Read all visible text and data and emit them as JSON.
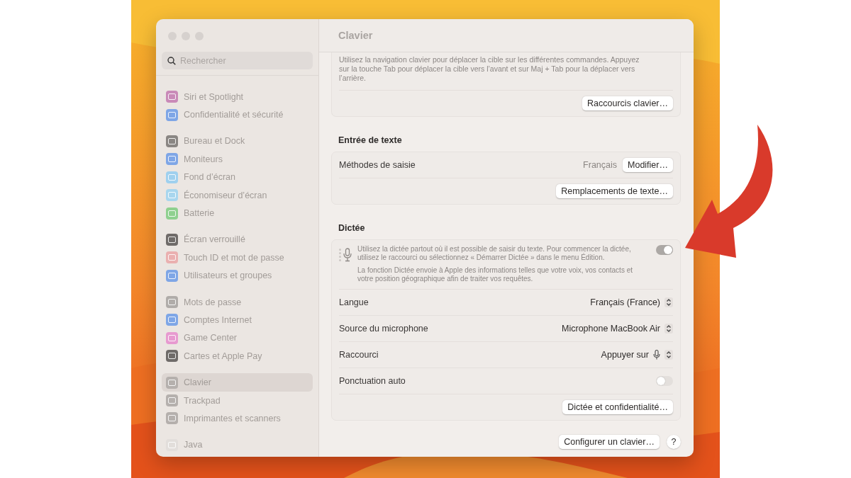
{
  "window": {
    "title": "Clavier"
  },
  "sidebar": {
    "search": {
      "placeholder": "Rechercher"
    },
    "groups": [
      {
        "items": [
          {
            "label": "Siri et Spotlight",
            "color": "#c98ab8",
            "selected": false
          },
          {
            "label": "Confidentialité et sécurité",
            "color": "#7fa6e6",
            "selected": false
          }
        ]
      },
      {
        "items": [
          {
            "label": "Bureau et Dock",
            "color": "#8a8683",
            "selected": false
          },
          {
            "label": "Moniteurs",
            "color": "#7fa6e6",
            "selected": false
          },
          {
            "label": "Fond d’écran",
            "color": "#9fd0ee",
            "selected": false
          },
          {
            "label": "Économiseur d’écran",
            "color": "#a8d6ee",
            "selected": false
          },
          {
            "label": "Batterie",
            "color": "#8fd08f",
            "selected": false
          }
        ]
      },
      {
        "items": [
          {
            "label": "Écran verrouillé",
            "color": "#6f6b69",
            "selected": false
          },
          {
            "label": "Touch ID et mot de passe",
            "color": "#eab0b0",
            "selected": false
          },
          {
            "label": "Utilisateurs et groupes",
            "color": "#7fa6e6",
            "selected": false
          }
        ]
      },
      {
        "items": [
          {
            "label": "Mots de passe",
            "color": "#b0aca9",
            "selected": false
          },
          {
            "label": "Comptes Internet",
            "color": "#7fa6e6",
            "selected": false
          },
          {
            "label": "Game Center",
            "color": "#e79ad0",
            "selected": false
          },
          {
            "label": "Cartes et Apple Pay",
            "color": "#6f6b69",
            "selected": false
          }
        ]
      },
      {
        "items": [
          {
            "label": "Clavier",
            "color": "#b5b0ad",
            "selected": true
          },
          {
            "label": "Trackpad",
            "color": "#b5b0ad",
            "selected": false
          },
          {
            "label": "Imprimantes et scanners",
            "color": "#b5b0ad",
            "selected": false
          }
        ]
      },
      {
        "items": [
          {
            "label": "Java",
            "color": "#e2dedb",
            "selected": false
          }
        ]
      }
    ]
  },
  "sections": [
    {
      "rows": [
        {
          "kind": "note",
          "text": "Utilisez la navigation clavier pour déplacer la cible sur les différentes commandes. Appuyez sur la touche Tab pour déplacer la cible vers l’avant et sur Maj + Tab pour la déplacer vers l’arrière."
        },
        {
          "kind": "button",
          "button": "Raccourcis clavier…"
        }
      ]
    },
    {
      "heading": "Entrée de texte",
      "rows": [
        {
          "kind": "value_button",
          "label": "Méthodes de saisie",
          "value": "Français",
          "button": "Modifier…"
        },
        {
          "kind": "button",
          "button": "Remplacements de texte…"
        }
      ]
    },
    {
      "heading": "Dictée",
      "rows": [
        {
          "kind": "info_toggle",
          "paragraphs": [
            "Utilisez la dictée partout où il est possible de saisir du texte. Pour commencer la dictée, utilisez le raccourci ou sélectionnez « Démarrer Dictée » dans le menu Édition.",
            "La fonction Dictée envoie à Apple des informations telles que votre voix, vos contacts et votre position géographique afin de traiter vos requêtes."
          ],
          "on": true
        },
        {
          "kind": "popup",
          "label": "Langue",
          "value": "Français (France)"
        },
        {
          "kind": "popup",
          "label": "Source du microphone",
          "value": "Microphone MacBook Air"
        },
        {
          "kind": "popup_mic",
          "label": "Raccourci",
          "value": "Appuyer sur"
        },
        {
          "kind": "toggle",
          "label": "Ponctuation auto",
          "on": false
        },
        {
          "kind": "button",
          "button": "Dictée et confidentialité…"
        }
      ]
    }
  ],
  "footer": {
    "button": "Configurer un clavier…",
    "help": "?"
  }
}
